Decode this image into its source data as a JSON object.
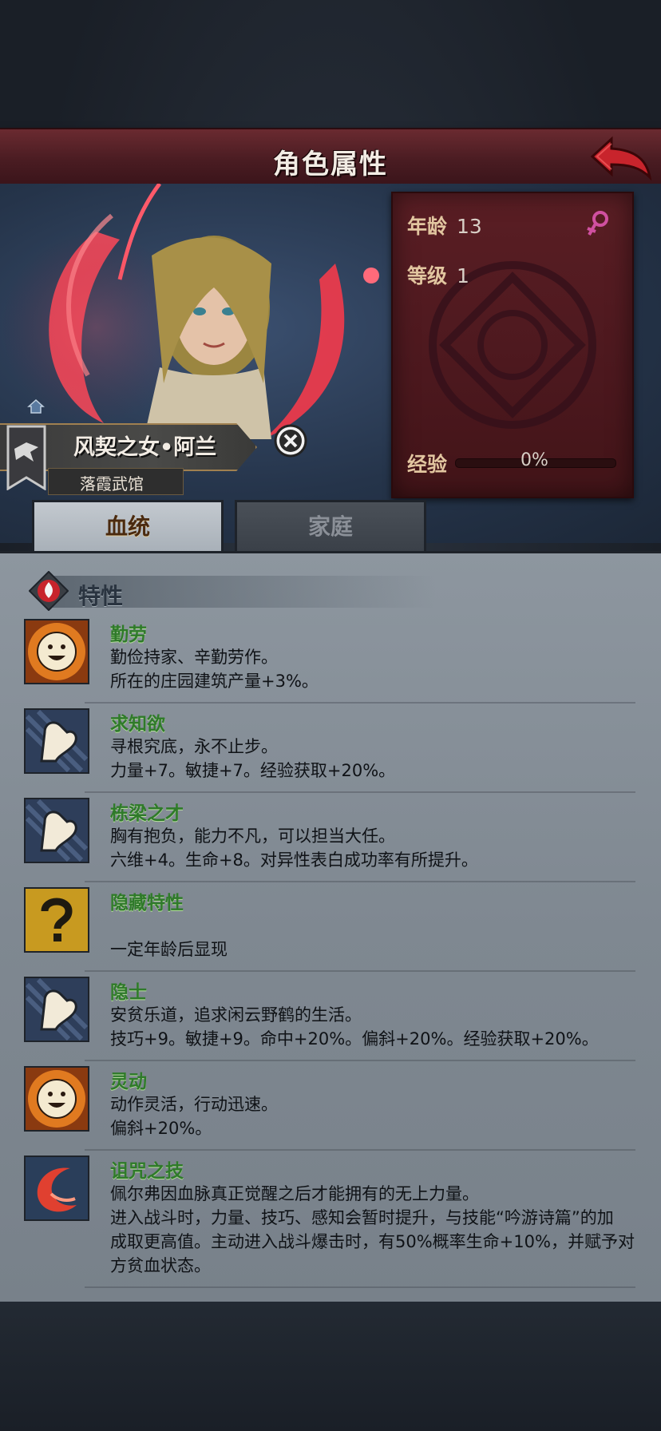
{
  "header": {
    "title": "角色属性"
  },
  "character": {
    "name": "风契之女•阿兰",
    "guild": "落霞武馆",
    "age_label": "年龄",
    "age_value": "13",
    "level_label": "等级",
    "level_value": "1",
    "exp_label": "经验",
    "exp_value": "0%",
    "exp_fraction": 0
  },
  "tabs": [
    {
      "label": "血统",
      "active": true
    },
    {
      "label": "家庭",
      "active": false
    }
  ],
  "section": {
    "title": "特性"
  },
  "traits": [
    {
      "name": "勤劳",
      "icon": "smile-sun-icon",
      "lines": [
        "勤俭持家、辛勤劳作。",
        "所在的庄园建筑产量+3%。"
      ]
    },
    {
      "name": "求知欲",
      "icon": "muscle-arm-icon",
      "lines": [
        "寻根究底，永不止步。",
        "力量+7。敏捷+7。经验获取+20%。"
      ]
    },
    {
      "name": "栋梁之才",
      "icon": "muscle-arm-icon",
      "lines": [
        "胸有抱负，能力不凡，可以担当大任。",
        "六维+4。生命+8。对异性表白成功率有所提升。"
      ]
    },
    {
      "name": "隐藏特性",
      "icon": "question-mark-icon",
      "lines": [
        "",
        "一定年龄后显现"
      ]
    },
    {
      "name": "隐士",
      "icon": "muscle-arm-icon",
      "lines": [
        "安贫乐道，追求闲云野鹤的生活。",
        "技巧+9。敏捷+9。命中+20%。偏斜+20%。经验获取+20%。"
      ]
    },
    {
      "name": "灵动",
      "icon": "smile-sun-icon",
      "lines": [
        "动作灵活，行动迅速。",
        "偏斜+20%。"
      ]
    },
    {
      "name": "诅咒之技",
      "icon": "crescent-flame-icon",
      "lines": [
        "佩尔弗因血脉真正觉醒之后才能拥有的无上力量。",
        "进入战斗时，力量、技巧、感知会暂时提升，与技能“吟游诗篇”的加",
        "成取更高值。主动进入战斗爆击时，有50%概率生命+10%，并赋予对",
        "方贫血状态。"
      ]
    }
  ]
}
